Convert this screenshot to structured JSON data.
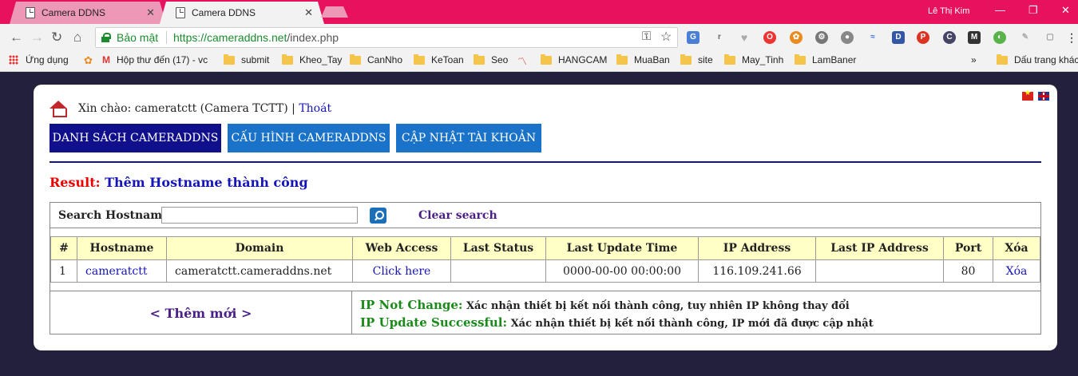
{
  "browser": {
    "tabs": [
      {
        "label": "Camera DDNS"
      },
      {
        "label": "Camera DDNS"
      }
    ],
    "user_name": "Lê Thị Kim",
    "secure_label": "Bảo mật",
    "url_host": "https://cameraddns.net",
    "url_path": "/index.php",
    "bookmarks": [
      {
        "label": "Ứng dụng"
      },
      {
        "label": "Hộp thư đến (17) - vc"
      },
      {
        "label": "submit"
      },
      {
        "label": "Kheo_Tay"
      },
      {
        "label": "CanNho"
      },
      {
        "label": "KeToan"
      },
      {
        "label": "Seo"
      },
      {
        "label": "HANGCAM"
      },
      {
        "label": "MuaBan"
      },
      {
        "label": "site"
      },
      {
        "label": "May_Tinh"
      },
      {
        "label": "LamBaner"
      },
      {
        "label": "Dấu trang khác"
      }
    ]
  },
  "page": {
    "greeting": "Xin chào: cameratctt (Camera TCTT)",
    "logout": "Thoát",
    "nav": [
      {
        "label": "DANH SÁCH CAMERADDNS"
      },
      {
        "label": "CẤU HÌNH CAMERADDNS"
      },
      {
        "label": "CẬP NHẬT TÀI KHOẢN"
      }
    ],
    "result_label": "Result:",
    "result_message": "Thêm Hostname thành công",
    "search": {
      "label": "Search Hostname:",
      "value": "",
      "clear_label": "Clear search"
    },
    "table": {
      "headers": [
        "#",
        "Hostname",
        "Domain",
        "Web Access",
        "Last Status",
        "Last Update Time",
        "IP Address",
        "Last IP Address",
        "Port",
        "Xóa"
      ],
      "rows": [
        [
          "1",
          "cameratctt",
          "cameratctt.cameraddns.net",
          "Click here",
          "",
          "0000-00-00 00:00:00",
          "116.109.241.66",
          "",
          "80",
          "Xóa"
        ]
      ]
    },
    "add_new": "< Thêm mới >",
    "legend": [
      {
        "status": "IP Not Change:",
        "desc": "Xác nhận thiết bị kết nối thành công, tuy nhiên IP không thay đổi"
      },
      {
        "status": "IP Update Successful:",
        "desc": "Xác nhận thiết bị kết nối thành công, IP mới đã được cập nhật"
      }
    ]
  }
}
